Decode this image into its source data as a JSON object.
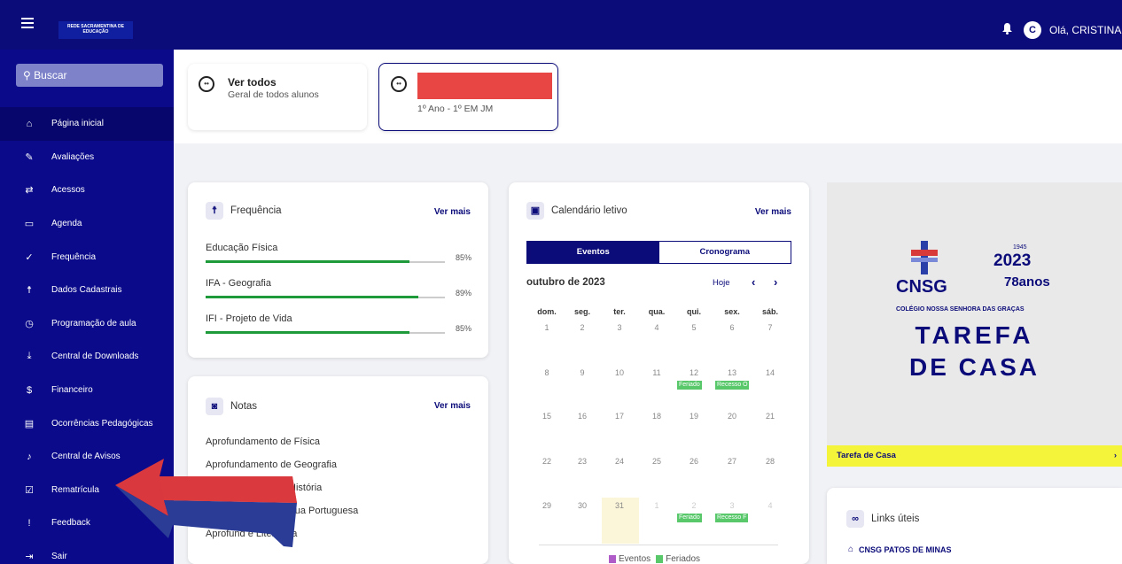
{
  "header": {
    "logo_text": "REDE SACRAMENTINA DE EDUCAÇÃO",
    "avatar_initial": "C",
    "greeting": "Olá, CRISTINA"
  },
  "sidebar": {
    "search_label": "Buscar",
    "items": [
      {
        "label": "Página inicial",
        "icon": "home-icon",
        "glyph": "⌂"
      },
      {
        "label": "Avaliações",
        "icon": "pencil-icon",
        "glyph": "✎"
      },
      {
        "label": "Acessos",
        "icon": "swap-icon",
        "glyph": "⇄"
      },
      {
        "label": "Agenda",
        "icon": "calendar-icon",
        "glyph": "▭"
      },
      {
        "label": "Frequência",
        "icon": "double-check-icon",
        "glyph": "✓"
      },
      {
        "label": "Dados Cadastrais",
        "icon": "person-icon",
        "glyph": "☨"
      },
      {
        "label": "Programação de aula",
        "icon": "clock-icon",
        "glyph": "◷"
      },
      {
        "label": "Central de Downloads",
        "icon": "download-icon",
        "glyph": "⤓"
      },
      {
        "label": "Financeiro",
        "icon": "dollar-icon",
        "glyph": "$"
      },
      {
        "label": "Ocorrências Pedagógicas",
        "icon": "document-icon",
        "glyph": "▤"
      },
      {
        "label": "Central de Avisos",
        "icon": "bell-icon",
        "glyph": "♪"
      },
      {
        "label": "Rematrícula",
        "icon": "checkbox-icon",
        "glyph": "☑"
      },
      {
        "label": "Feedback",
        "icon": "feedback-icon",
        "glyph": "!"
      },
      {
        "label": "Sair",
        "icon": "logout-icon",
        "glyph": "⇥"
      }
    ]
  },
  "students": {
    "all_title": "Ver todos",
    "all_subtitle": "Geral de todos alunos",
    "selected_class": "1º Ano - 1º EM JM"
  },
  "frequencia": {
    "title": "Frequência",
    "ver_mais": "Ver mais",
    "rows": [
      {
        "name": "Educação Física",
        "pct": "85%",
        "value": 0.85
      },
      {
        "name": "IFA - Geografia",
        "pct": "89%",
        "value": 0.89
      },
      {
        "name": "IFI - Projeto de Vida",
        "pct": "85%",
        "value": 0.85
      }
    ]
  },
  "notas": {
    "title": "Notas",
    "ver_mais": "Ver mais",
    "items": [
      "Aprofundamento de Física",
      "Aprofundamento de Geografia",
      "História",
      "de Língua Portuguesa",
      "Aprofund e Literatura"
    ]
  },
  "calendario": {
    "title": "Calendário letivo",
    "ver_mais": "Ver mais",
    "tab_eventos": "Eventos",
    "tab_cronograma": "Cronograma",
    "month": "outubro de 2023",
    "hoje": "Hoje",
    "prev": "‹",
    "next": "›",
    "weekdays": [
      "dom.",
      "seg.",
      "ter.",
      "qua.",
      "qui.",
      "sex.",
      "sáb."
    ],
    "weeks": [
      [
        "1",
        "2",
        "3",
        "4",
        "5",
        "6",
        "7"
      ],
      [
        "8",
        "9",
        "10",
        "11",
        "12",
        "13",
        "14"
      ],
      [
        "15",
        "16",
        "17",
        "18",
        "19",
        "20",
        "21"
      ],
      [
        "22",
        "23",
        "24",
        "25",
        "26",
        "27",
        "28"
      ],
      [
        "29",
        "30",
        "31",
        "1",
        "2",
        "3",
        "4"
      ]
    ],
    "tags": [
      {
        "week": 1,
        "day": 4,
        "label": "Feriado"
      },
      {
        "week": 1,
        "day": 5,
        "label": "Recesso O"
      },
      {
        "week": 4,
        "day": 4,
        "label": "Feriado"
      },
      {
        "week": 4,
        "day": 5,
        "label": "Recesso F"
      }
    ],
    "legend_eventos": "Eventos",
    "legend_feriados": "Feriados",
    "colors": {
      "eventos": "#b05cc8",
      "feriados": "#58c86b",
      "today": "#fbf5d9"
    }
  },
  "tarefa": {
    "cnsg": "CNSG",
    "year_top": "1945",
    "year": "2023",
    "anos": "78anos",
    "colegio": "COLÉGIO NOSSA SENHORA DAS GRAÇAS",
    "line1": "TAREFA",
    "line2": "DE CASA",
    "bar_label": "Tarefa de Casa",
    "bar_chevron": "›"
  },
  "links": {
    "title": "Links úteis",
    "item": "CNSG PATOS DE MINAS"
  },
  "colors": {
    "primary": "#0b0b7a",
    "accent_red": "#e84545",
    "progress": "#1f9a3b"
  }
}
